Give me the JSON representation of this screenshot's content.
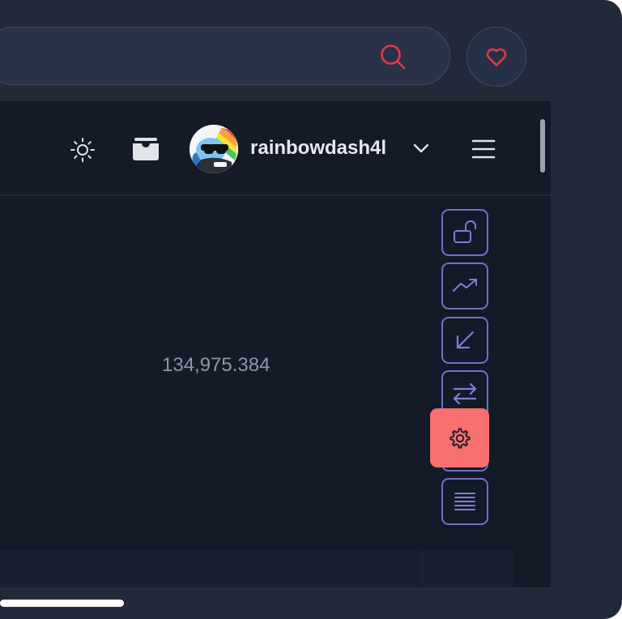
{
  "search": {
    "value": "",
    "placeholder": ""
  },
  "icons": {
    "search": "search-icon",
    "favorite": "heart-icon",
    "theme": "sun-icon",
    "wallet": "wallet-icon",
    "menu": "hamburger-menu-icon",
    "user_dropdown": "chevron-down-icon"
  },
  "user": {
    "username": "rainbowdash4l"
  },
  "main": {
    "value": "134,975.384"
  },
  "sidebar_tools": [
    {
      "name": "unlock-icon"
    },
    {
      "name": "trending-up-icon"
    },
    {
      "name": "arrow-down-left-icon"
    },
    {
      "name": "swap-arrows-icon"
    },
    {
      "name": "settings-icon"
    },
    {
      "name": "order-book-icon"
    }
  ],
  "colors": {
    "accent_red": "#e23a4a",
    "settings_fab": "#f7706f",
    "tool_border": "#6f72c8",
    "background": "#141a27",
    "frame": "#222a3a"
  }
}
